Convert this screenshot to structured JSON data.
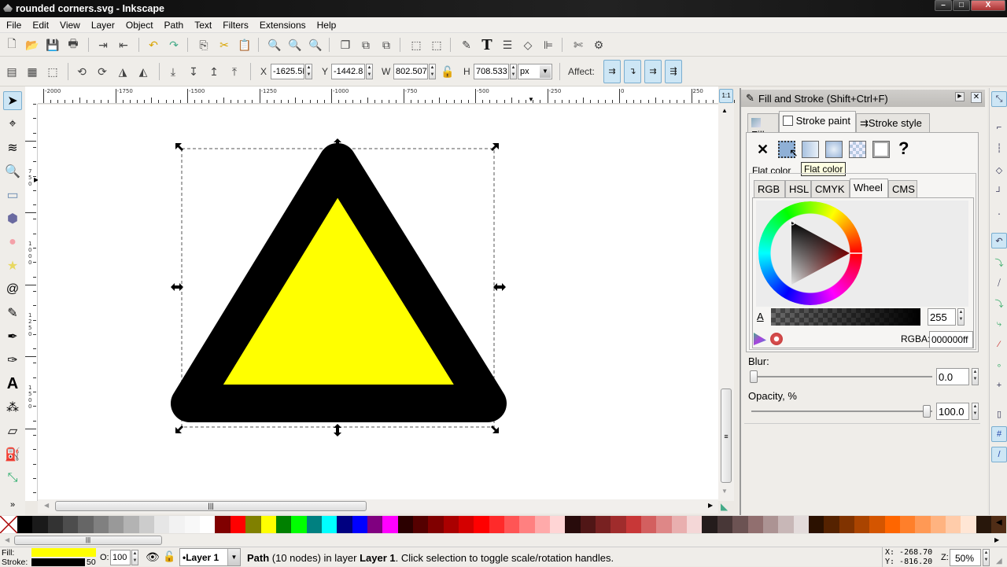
{
  "window": {
    "title": "rounded corners.svg - Inkscape",
    "buttons": {
      "minimize": "–",
      "maximize": "□",
      "close": "X"
    }
  },
  "menu": [
    "File",
    "Edit",
    "View",
    "Layer",
    "Object",
    "Path",
    "Text",
    "Filters",
    "Extensions",
    "Help"
  ],
  "commands_toolbar": [
    {
      "name": "new-document-icon",
      "glyph": "🗋"
    },
    {
      "name": "open-icon",
      "glyph": "📂"
    },
    {
      "name": "save-icon",
      "glyph": "💾"
    },
    {
      "name": "print-icon",
      "glyph": "🖶"
    },
    {
      "name": "import-icon",
      "glyph": "⇥"
    },
    {
      "name": "export-icon",
      "glyph": "⇤"
    },
    {
      "name": "undo-icon",
      "glyph": "↶"
    },
    {
      "name": "redo-icon",
      "glyph": "↷"
    },
    {
      "name": "copy-icon",
      "glyph": "⎘"
    },
    {
      "name": "cut-icon",
      "glyph": "✂"
    },
    {
      "name": "paste-icon",
      "glyph": "📋"
    },
    {
      "name": "zoom-selection-icon",
      "glyph": "🔍"
    },
    {
      "name": "zoom-drawing-icon",
      "glyph": "🔍"
    },
    {
      "name": "zoom-page-icon",
      "glyph": "🔍"
    },
    {
      "name": "duplicate-icon",
      "glyph": "❐"
    },
    {
      "name": "clone-icon",
      "glyph": "⧉"
    },
    {
      "name": "unlink-clone-icon",
      "glyph": "⧉"
    },
    {
      "name": "group-icon",
      "glyph": "⬚"
    },
    {
      "name": "ungroup-icon",
      "glyph": "⬚"
    },
    {
      "name": "fill-stroke-icon",
      "glyph": "✎"
    },
    {
      "name": "text-font-icon",
      "glyph": "T"
    },
    {
      "name": "layers-icon",
      "glyph": "☰"
    },
    {
      "name": "xml-editor-icon",
      "glyph": "◇"
    },
    {
      "name": "align-distribute-icon",
      "glyph": "⊫"
    },
    {
      "name": "preferences-icon",
      "glyph": "✄"
    },
    {
      "name": "document-properties-icon",
      "glyph": "⚙"
    }
  ],
  "select_toolbar": {
    "x_label": "X",
    "x_value": "-1625.5I",
    "y_label": "Y",
    "y_value": "-1442.8",
    "w_label": "W",
    "w_value": "802.507",
    "h_label": "H",
    "h_value": "708.533",
    "unit": "px",
    "affect_label": "Affect:"
  },
  "ruler": {
    "h_labels": [
      "-2000",
      "-1750",
      "-1500",
      "-1250",
      "-1000",
      "-750",
      "-500",
      "-250",
      "0",
      "250"
    ],
    "v_labels": [
      "750",
      "1000",
      "1250",
      "1500"
    ]
  },
  "tools": [
    {
      "name": "selector-tool",
      "glyph": "➤",
      "active": true
    },
    {
      "name": "node-tool",
      "glyph": "⌖"
    },
    {
      "name": "tweak-tool",
      "glyph": "≋"
    },
    {
      "name": "zoom-tool",
      "glyph": "🔍"
    },
    {
      "name": "rectangle-tool",
      "glyph": "▭"
    },
    {
      "name": "3d-box-tool",
      "glyph": "⬢"
    },
    {
      "name": "ellipse-tool",
      "glyph": "●"
    },
    {
      "name": "star-tool",
      "glyph": "★"
    },
    {
      "name": "spiral-tool",
      "glyph": "@"
    },
    {
      "name": "pencil-tool",
      "glyph": "✎"
    },
    {
      "name": "pen-tool",
      "glyph": "✒"
    },
    {
      "name": "calligraphy-tool",
      "glyph": "✑"
    },
    {
      "name": "text-tool",
      "glyph": "A"
    },
    {
      "name": "spray-tool",
      "glyph": "⁂"
    },
    {
      "name": "eraser-tool",
      "glyph": "▱"
    },
    {
      "name": "paint-bucket-tool",
      "glyph": "⛽"
    },
    {
      "name": "connector-tool",
      "glyph": "⤡"
    }
  ],
  "tools_more": "»",
  "dock": {
    "title": "Fill and Stroke (Shift+Ctrl+F)",
    "tabs": [
      {
        "label": "Fill"
      },
      {
        "label": "Stroke paint",
        "active": true
      },
      {
        "label": "Stroke style"
      }
    ],
    "paint_types": [
      "no-paint",
      "flat-color",
      "linear-gradient",
      "radial-gradient",
      "pattern",
      "swatch",
      "unset"
    ],
    "tooltip": "Flat color",
    "section_label": "Flat color",
    "color_tabs": [
      "RGB",
      "HSL",
      "CMYK",
      "Wheel",
      "CMS"
    ],
    "active_color_tab": "Wheel",
    "alpha_label": "A",
    "alpha_value": "255",
    "rgba_label": "RGBA:",
    "rgba_value": "000000ff",
    "blur_label": "Blur:",
    "blur_value": "0.0",
    "opacity_label": "Opacity, %",
    "opacity_value": "100.0"
  },
  "palette": [
    "#000000",
    "#1a1a1a",
    "#333333",
    "#4d4d4d",
    "#666666",
    "#808080",
    "#999999",
    "#b3b3b3",
    "#cccccc",
    "#e6e6e6",
    "#f2f2f2",
    "#f8f8f8",
    "#ffffff",
    "#800000",
    "#ff0000",
    "#808000",
    "#ffff00",
    "#008000",
    "#00ff00",
    "#008080",
    "#00ffff",
    "#000080",
    "#0000ff",
    "#800080",
    "#ff00ff",
    "#2b0000",
    "#550000",
    "#800000",
    "#aa0000",
    "#d40000",
    "#ff0000",
    "#ff2a2a",
    "#ff5555",
    "#ff8080",
    "#ffaaaa",
    "#ffd5d5",
    "#280b0b",
    "#501616",
    "#782121",
    "#a02c2c",
    "#c83737",
    "#d35f5f",
    "#de8787",
    "#e9afaf",
    "#f4d7d7",
    "#241c1c",
    "#483737",
    "#6c5353",
    "#916f6f",
    "#ac9393",
    "#c8b7b7",
    "#e3dbdb",
    "#2b1100",
    "#552200",
    "#803300",
    "#aa4400",
    "#d45500",
    "#ff6600",
    "#ff7f2a",
    "#ff9955",
    "#ffb380",
    "#ffccaa",
    "#ffe6d5",
    "#28170b",
    "#502d16"
  ],
  "status": {
    "fill_label": "Fill:",
    "stroke_label": "Stroke:",
    "fill_color": "#ffff00",
    "stroke_color": "#000000",
    "stroke_width": "50",
    "opacity_label": "O:",
    "opacity_value": "100",
    "layer": "•Layer 1",
    "message_bold1": "Path",
    "message_part1": " (10 nodes) in layer ",
    "message_bold2": "Layer 1",
    "message_part2": ". Click selection to toggle scale/rotation handles.",
    "cursor_x": "X: -268.70",
    "cursor_y": "Y: -816.20",
    "zoom_label": "Z:",
    "zoom_value": "50%"
  },
  "drawing": {
    "fill": "#ffff00",
    "stroke": "#000000"
  }
}
